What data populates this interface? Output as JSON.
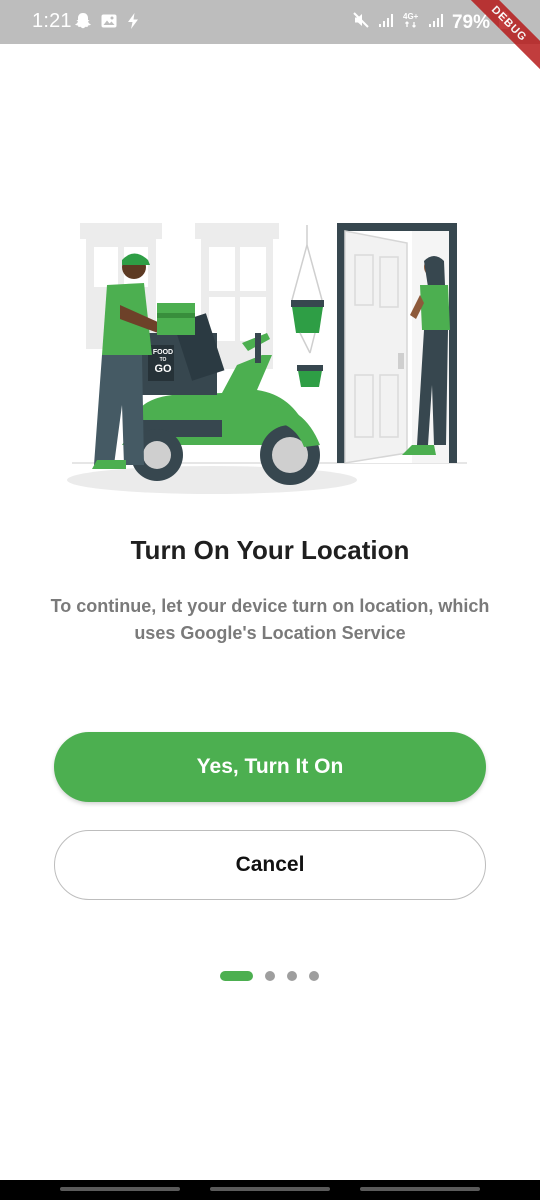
{
  "status_bar": {
    "time": "1:21",
    "battery": "79%",
    "debug_label": "DEBUG",
    "left_icons": [
      "snapchat-icon",
      "image-icon",
      "flash-icon"
    ],
    "right_icons": [
      "mute-icon",
      "signal-icon",
      "4g-icon",
      "signal-icon",
      "battery-icon"
    ]
  },
  "illustration": {
    "box_text_line1": "FOOD",
    "box_text_line2": "TO",
    "box_text_line3": "GO"
  },
  "content": {
    "title": "Turn On Your Location",
    "subtitle": "To continue, let your device turn on location, which uses Google's Location Service"
  },
  "buttons": {
    "primary_label": "Yes, Turn It On",
    "secondary_label": "Cancel"
  },
  "pager": {
    "current_page": 1,
    "total_pages": 4
  },
  "colors": {
    "accent": "#4caf50",
    "title": "#1f1f1f",
    "subtitle": "#7a7a7a",
    "status_bar": "#bdbdbd",
    "dot_inactive": "#9e9e9e"
  }
}
